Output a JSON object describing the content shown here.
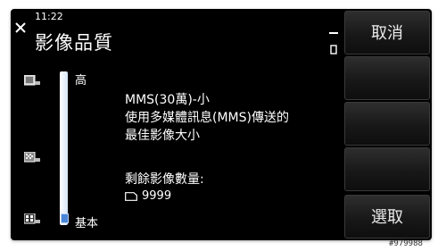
{
  "status": {
    "time": "11:22"
  },
  "header": {
    "title": "影像品質"
  },
  "slider": {
    "high_label": "高",
    "low_label": "基本",
    "level_fraction": 0
  },
  "info": {
    "line1": "MMS(30萬)-小",
    "line2": "使用多媒體訊息(MMS)傳送的",
    "line3": "最佳影像大小",
    "remaining_label": "剩餘影像數量:",
    "remaining_count": "9999"
  },
  "softkeys": {
    "top": "取消",
    "bottom": "選取"
  },
  "watermark": "#979988",
  "colors": {
    "background": "#000000",
    "accent": "#4a86d8"
  }
}
